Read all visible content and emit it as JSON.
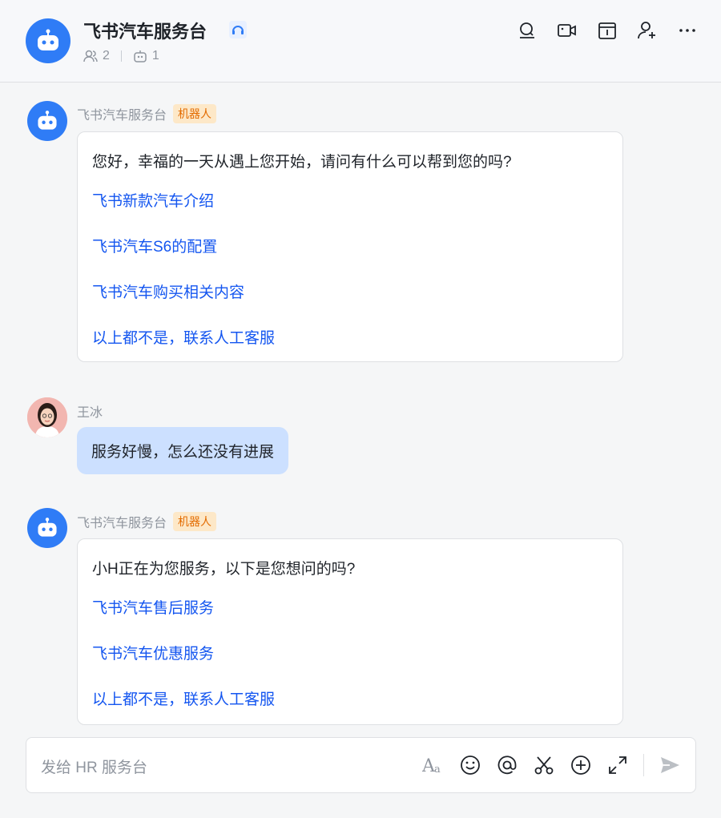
{
  "header": {
    "title": "飞书汽车服务台",
    "member_count": "2",
    "bot_count": "1"
  },
  "messages": [
    {
      "sender": "飞书汽车服务台",
      "tag": "机器人",
      "question": "您好，幸福的一天从遇上您开始，请问有什么可以帮到您的吗?",
      "options": [
        "飞书新款汽车介绍",
        "飞书汽车S6的配置",
        "飞书汽车购买相关内容",
        "以上都不是，联系人工客服"
      ]
    },
    {
      "sender": "王冰",
      "text": "服务好慢，怎么还没有进展"
    },
    {
      "sender": "飞书汽车服务台",
      "tag": "机器人",
      "question": "小H正在为您服务，以下是您想问的吗?",
      "options": [
        "飞书汽车售后服务",
        "飞书汽车优惠服务",
        "以上都不是，联系人工客服"
      ]
    }
  ],
  "input": {
    "placeholder": "发给 HR 服务台"
  },
  "colors": {
    "accent": "#2f7cf6",
    "link": "#1456f0",
    "bubble": "#cce0ff",
    "tag_bg": "#fde8c8",
    "tag_text": "#e36b00"
  }
}
